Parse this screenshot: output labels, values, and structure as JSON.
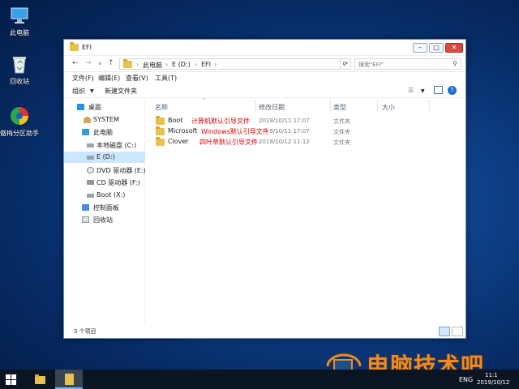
{
  "desktop": {
    "icons": [
      {
        "label": "此电脑"
      },
      {
        "label": "回收站"
      },
      {
        "label": "傲梅分区助手"
      }
    ]
  },
  "window": {
    "title": "EFI",
    "address": [
      "此电脑",
      "E (D:)",
      "EFI"
    ],
    "search_placeholder": "搜索\"EFI\"",
    "menu": [
      "文件(F)",
      "编辑(E)",
      "查看(V)",
      "工具(T)"
    ],
    "toolbar": {
      "organize": "组织",
      "new_folder": "新建文件夹"
    },
    "columns": {
      "name": "名称",
      "date": "修改日期",
      "type": "类型",
      "size": "大小"
    },
    "nav": [
      {
        "label": "桌面",
        "icon": "desktop-icon"
      },
      {
        "label": "SYSTEM",
        "icon": "user-icon"
      },
      {
        "label": "此电脑",
        "icon": "computer-icon"
      },
      {
        "label": "本地磁盘 (C:)",
        "icon": "drive-icon"
      },
      {
        "label": "E (D:)",
        "icon": "drive-icon"
      },
      {
        "label": "DVD 驱动器 (E:) V",
        "icon": "dvd-icon"
      },
      {
        "label": "CD 驱动器 (F:)",
        "icon": "cd-icon"
      },
      {
        "label": "Boot (X:)",
        "icon": "drive-icon"
      },
      {
        "label": "控制面板",
        "icon": "control-panel-icon"
      },
      {
        "label": "回收站",
        "icon": "recycle-bin-icon"
      }
    ],
    "files": [
      {
        "name": "Boot",
        "date": "2019/10/11 17:07",
        "type": "文件夹",
        "annotation": "计算机默认引导文件"
      },
      {
        "name": "Microsoft",
        "date": "2019/10/11 17:07",
        "type": "文件夹",
        "annotation": "Windows默认引导文件"
      },
      {
        "name": "Clover",
        "date": "2019/10/12 11:12",
        "type": "文件夹",
        "annotation": "四叶草默认引导文件"
      }
    ],
    "status": "3 个项目"
  },
  "taskbar": {
    "lang": "ENG",
    "time": "11:1",
    "date": "2019/10/12"
  },
  "watermark": "电脑技术吧"
}
